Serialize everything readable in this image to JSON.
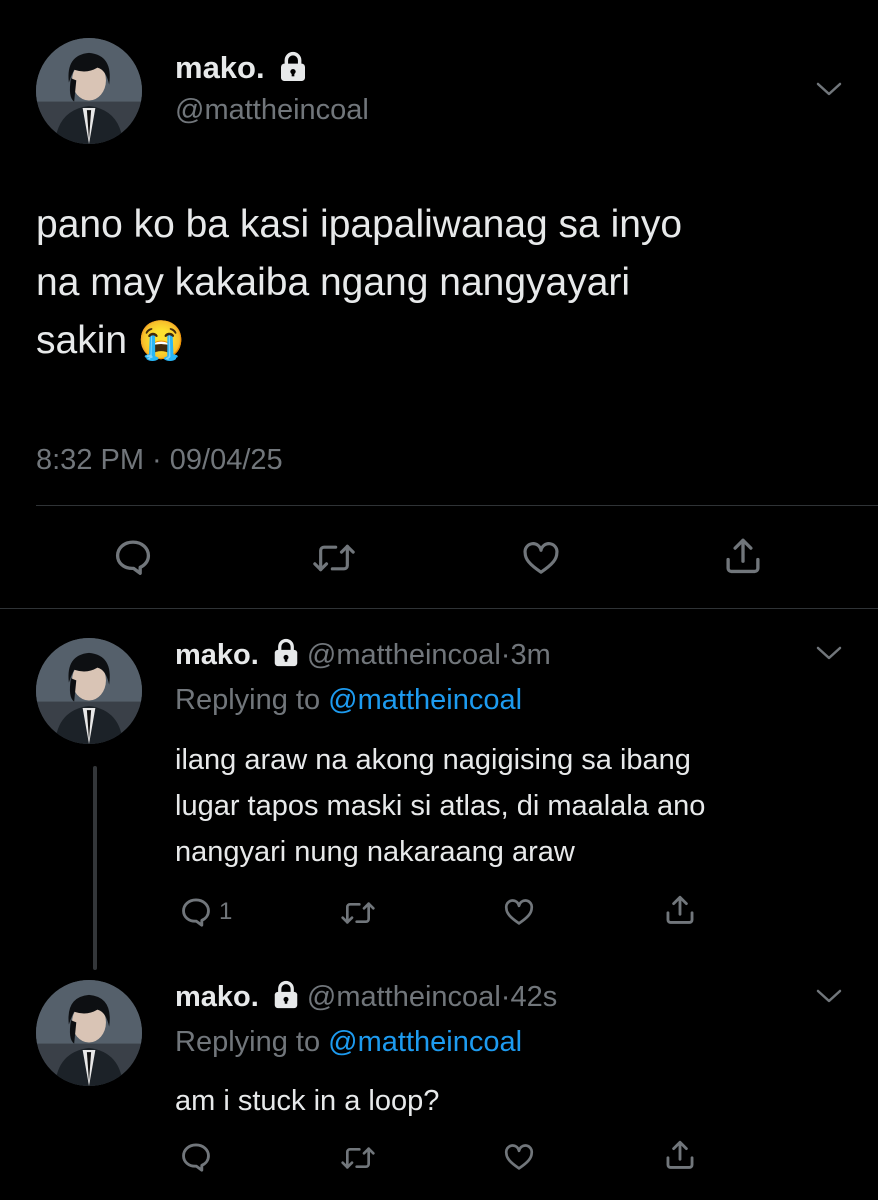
{
  "main_tweet": {
    "display_name": "mako.",
    "handle": "@mattheincoal",
    "text_lines": [
      "pano ko ba kasi ipapaliwanag sa inyo",
      "na may kakaiba ngang nangyayari",
      "sakin"
    ],
    "emoji": "😭",
    "timestamp": "8:32 PM · 09/04/25"
  },
  "replies": [
    {
      "display_name": "mako.",
      "handle": "@mattheincoal",
      "time": "3m",
      "replying_to_label": "Replying to",
      "replying_to": "@mattheincoal",
      "text_lines": [
        "ilang araw na akong nagigising sa ibang",
        "lugar tapos maski si atlas, di maalala ano",
        "nangyari nung nakaraang araw"
      ],
      "reply_count": "1"
    },
    {
      "display_name": "mako.",
      "handle": "@mattheincoal",
      "time": "42s",
      "replying_to_label": "Replying to",
      "replying_to": "@mattheincoal",
      "text_lines": [
        "am i stuck in a loop?"
      ],
      "reply_count": ""
    }
  ],
  "icons": {
    "verified_lock": "lock-icon",
    "more": "chevron-down-icon",
    "reply": "reply-icon",
    "retweet": "retweet-icon",
    "like": "heart-icon",
    "share": "share-icon"
  },
  "colors": {
    "background": "#000000",
    "text": "#e7e9ea",
    "muted": "#71767b",
    "link": "#1d9bf0",
    "divider": "#2f3336"
  }
}
